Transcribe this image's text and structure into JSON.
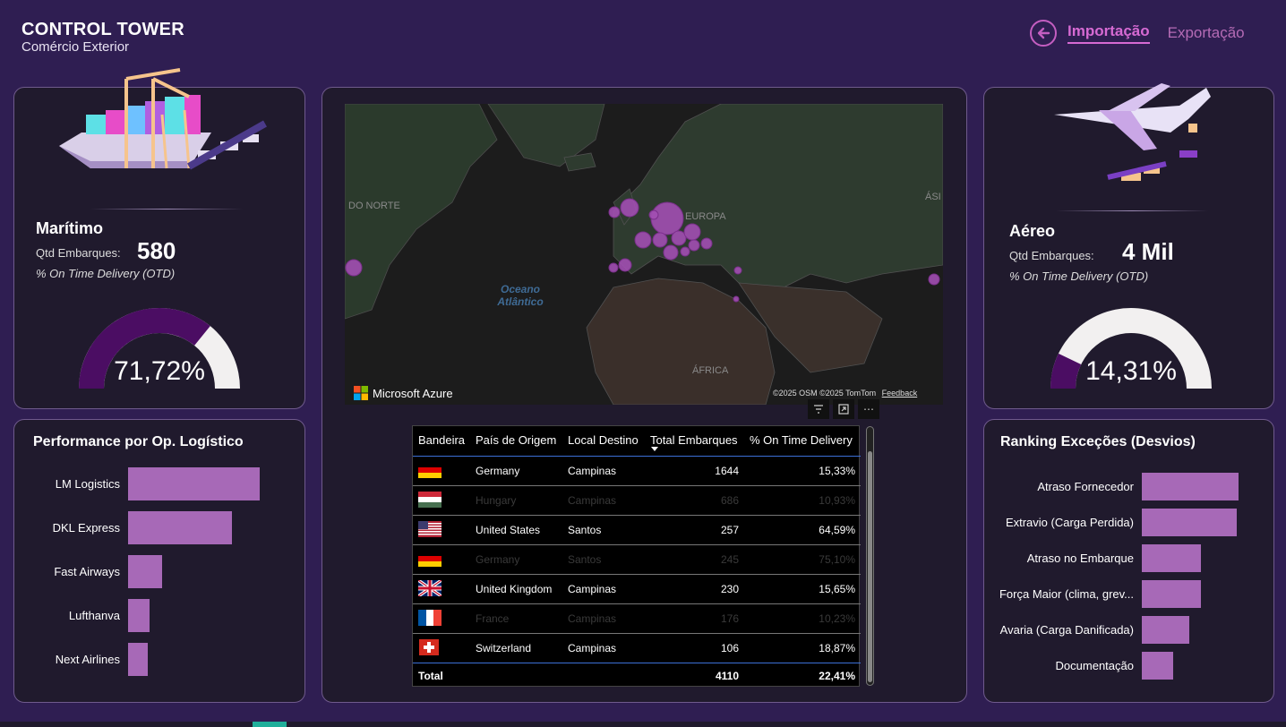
{
  "header": {
    "title": "CONTROL TOWER",
    "subtitle": "Comércio Exterior",
    "nav_import": "Importação",
    "nav_export": "Exportação"
  },
  "maritimo": {
    "title": "Marítimo",
    "qtd_label": "Qtd Embarques:",
    "qtd_value": "580",
    "otd_label": "% On Time Delivery (OTD)",
    "gauge_value": 0.7172,
    "gauge_text": "71,72%"
  },
  "aereo": {
    "title": "Aéreo",
    "qtd_label": "Qtd Embarques:",
    "qtd_value": "4 Mil",
    "otd_label": "% On Time Delivery (OTD)",
    "gauge_value": 0.1431,
    "gauge_text": "14,31%"
  },
  "map": {
    "labels": {
      "north": "DO NORTE",
      "europe": "EUROPA",
      "africa": "ÁFRICA",
      "asia": "ÁSI",
      "ocean_line1": "Oceano",
      "ocean_line2": "Atlântico"
    },
    "brand": "Microsoft Azure",
    "attribution": "©2025 OSM  ©2025 TomTom",
    "feedback": "Feedback"
  },
  "table": {
    "columns": [
      "Bandeira",
      "País de Origem",
      "Local Destino",
      "Total Embarques",
      "% On Time Delivery"
    ],
    "rows": [
      {
        "flag": "de",
        "country": "Germany",
        "dest": "Campinas",
        "total": "1644",
        "otd": "15,33%",
        "dim": false
      },
      {
        "flag": "hu",
        "country": "Hungary",
        "dest": "Campinas",
        "total": "686",
        "otd": "10,93%",
        "dim": true
      },
      {
        "flag": "us",
        "country": "United States",
        "dest": "Santos",
        "total": "257",
        "otd": "64,59%",
        "dim": false
      },
      {
        "flag": "de",
        "country": "Germany",
        "dest": "Santos",
        "total": "245",
        "otd": "75,10%",
        "dim": true
      },
      {
        "flag": "gb",
        "country": "United Kingdom",
        "dest": "Campinas",
        "total": "230",
        "otd": "15,65%",
        "dim": false
      },
      {
        "flag": "fr",
        "country": "France",
        "dest": "Campinas",
        "total": "176",
        "otd": "10,23%",
        "dim": true
      },
      {
        "flag": "ch",
        "country": "Switzerland",
        "dest": "Campinas",
        "total": "106",
        "otd": "18,87%",
        "dim": false
      }
    ],
    "total_label": "Total",
    "total_value": "4110",
    "total_otd": "22,41%"
  },
  "performance": {
    "title": "Performance por Op. Logístico",
    "chart_data": {
      "type": "bar",
      "categories": [
        "LM Logistics",
        "DKL Express",
        "Fast Airways",
        "Lufthanva",
        "Next Airlines"
      ],
      "values": [
        100,
        79,
        26,
        16,
        15
      ]
    }
  },
  "ranking": {
    "title": "Ranking Exceções (Desvios)",
    "chart_data": {
      "type": "bar",
      "categories": [
        "Atraso Fornecedor",
        "Extravio (Carga Perdida)",
        "Atraso no Embarque",
        "Força Maior (clima, grev...",
        "Avaria (Carga Danificada)",
        "Documentação"
      ],
      "values": [
        100,
        98,
        61,
        61,
        49,
        32
      ]
    }
  },
  "colors": {
    "accent": "#d66ad3",
    "bar": "#a769b7",
    "gauge_fill": "#4b0d63",
    "gauge_track": "#f2f0f0"
  }
}
